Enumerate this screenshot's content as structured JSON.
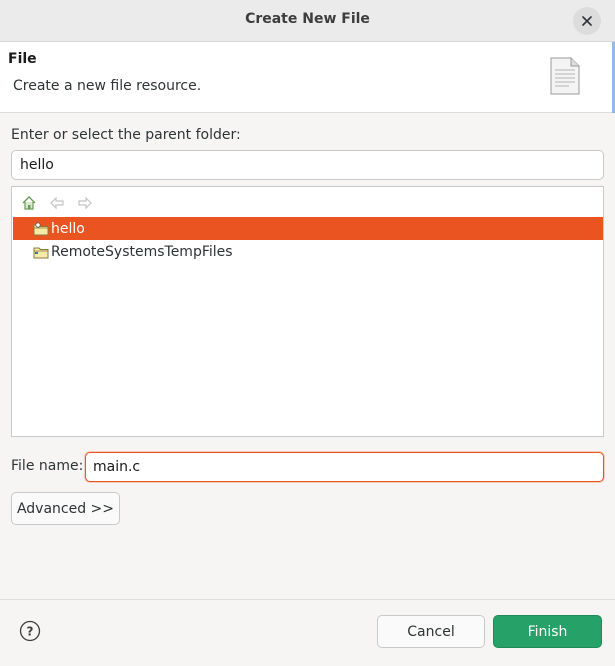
{
  "window": {
    "title": "Create New File"
  },
  "header": {
    "title": "File",
    "description": "Create a new file resource.",
    "icon": "document-icon"
  },
  "parent_folder": {
    "label": "Enter or select the parent folder:",
    "value": "hello"
  },
  "tree": {
    "toolbar": [
      "home-icon",
      "back-arrow-icon",
      "forward-arrow-icon"
    ],
    "items": [
      {
        "label": "hello",
        "selected": true,
        "icon": "project-folder-icon"
      },
      {
        "label": "RemoteSystemsTempFiles",
        "selected": false,
        "icon": "project-folder-icon"
      }
    ]
  },
  "file_name": {
    "label": "File name:",
    "value": "main.c"
  },
  "buttons": {
    "advanced": "Advanced >>",
    "cancel": "Cancel",
    "finish": "Finish"
  },
  "colors": {
    "accent": "#e95420",
    "finish": "#26a269"
  }
}
